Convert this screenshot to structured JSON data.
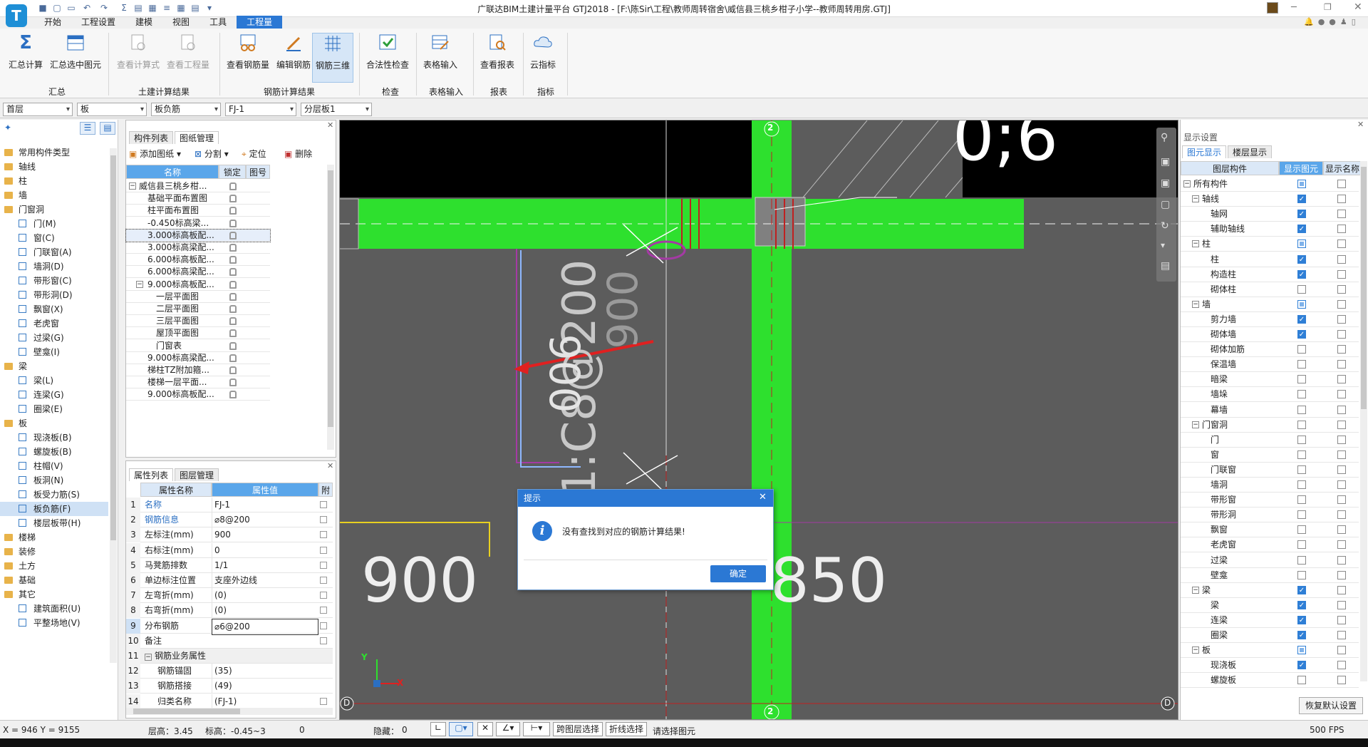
{
  "window": {
    "title": "广联达BIM土建计量平台 GTJ2018 - [F:\\陈Sir\\工程\\教师周转宿舍\\威信县三桃乡柑子小学--教师周转用房.GTJ]"
  },
  "menu": [
    "开始",
    "工程设置",
    "建模",
    "视图",
    "工具",
    "工程量"
  ],
  "ribbon": {
    "buttons": [
      "汇总计算",
      "汇总选中图元",
      "查看计算式",
      "查看工程量",
      "查看钢筋量",
      "编辑钢筋",
      "钢筋三维",
      "合法性检查",
      "表格输入",
      "查看报表",
      "云指标"
    ],
    "groups": [
      "汇总",
      "土建计算结果",
      "钢筋计算结果",
      "检查",
      "表格输入",
      "报表",
      "指标"
    ]
  },
  "combos": [
    "首层",
    "板",
    "板负筋",
    "FJ-1",
    "分层板1"
  ],
  "leftnav": {
    "items": [
      "常用构件类型",
      "轴线",
      "柱",
      "墙",
      "门窗洞",
      "门(M)",
      "窗(C)",
      "门联窗(A)",
      "墙洞(D)",
      "带形窗(C)",
      "带形洞(D)",
      "飘窗(X)",
      "老虎窗",
      "过梁(G)",
      "壁龛(I)",
      "梁",
      "梁(L)",
      "连梁(G)",
      "圈梁(E)",
      "板",
      "现浇板(B)",
      "螺旋板(B)",
      "柱帽(V)",
      "板洞(N)",
      "板受力筋(S)",
      "板负筋(F)",
      "楼层板带(H)",
      "楼梯",
      "装修",
      "土方",
      "基础",
      "其它",
      "建筑面积(U)",
      "平整场地(V)"
    ]
  },
  "drawings": {
    "tabs": [
      "构件列表",
      "图纸管理"
    ],
    "toolbar": [
      "添加图纸",
      "分割",
      "定位",
      "删除"
    ],
    "columns": [
      "名称",
      "锁定",
      "图号"
    ],
    "rows": [
      "威信县三桃乡柑...",
      "基础平面布置图",
      "柱平面布置图",
      "-0.450标高梁...",
      "3.000标高板配...",
      "3.000标高梁配...",
      "6.000标高板配...",
      "6.000标高梁配...",
      "9.000标高板配...",
      "一层平面图",
      "二层平面图",
      "三层平面图",
      "屋顶平面图",
      "门窗表",
      "9.000标高梁配...",
      "梯柱TZ附加箍...",
      "楼梯一层平面...",
      "9.000标高板配..."
    ]
  },
  "props": {
    "tabs": [
      "属性列表",
      "图层管理"
    ],
    "columns": [
      "属性名称",
      "属性值",
      "附"
    ],
    "rows": [
      {
        "n": "1",
        "name": "名称",
        "val": "FJ-1"
      },
      {
        "n": "2",
        "name": "钢筋信息",
        "val": "⌀8@200"
      },
      {
        "n": "3",
        "name": "左标注(mm)",
        "val": "900"
      },
      {
        "n": "4",
        "name": "右标注(mm)",
        "val": "0"
      },
      {
        "n": "5",
        "name": "马凳筋排数",
        "val": "1/1"
      },
      {
        "n": "6",
        "name": "单边标注位置",
        "val": "支座外边线"
      },
      {
        "n": "7",
        "name": "左弯折(mm)",
        "val": "(0)"
      },
      {
        "n": "8",
        "name": "右弯折(mm)",
        "val": "(0)"
      },
      {
        "n": "9",
        "name": "分布钢筋",
        "val": "⌀6@200"
      },
      {
        "n": "10",
        "name": "备注",
        "val": ""
      },
      {
        "n": "11",
        "name": "钢筋业务属性",
        "val": ""
      },
      {
        "n": "12",
        "name": "钢筋锚固",
        "val": "(35)"
      },
      {
        "n": "13",
        "name": "钢筋搭接",
        "val": "(49)"
      },
      {
        "n": "14",
        "name": "归类名称",
        "val": "(FJ-1)"
      }
    ]
  },
  "canvas": {
    "texts": {
      "beam_label": "FJ-1:C8@200",
      "dim_900_a": "900",
      "dim_900_b": "900",
      "dim_900_c": "900",
      "dim_850": "850",
      "big": "0;6",
      "axis_2": "2",
      "axis_d": "D",
      "x": "X",
      "y": "Y"
    }
  },
  "dialog": {
    "title": "提示",
    "message": "没有查找到对应的钢筋计算结果!",
    "ok": "确定"
  },
  "display": {
    "title": "显示设置",
    "tabs": [
      "图元显示",
      "楼层显示"
    ],
    "columns": [
      "图层构件",
      "显示图元",
      "显示名称"
    ],
    "rows": [
      {
        "name": "所有构件",
        "lvl": 0,
        "show": "part",
        "label": "off"
      },
      {
        "name": "轴线",
        "lvl": 1,
        "show": "on",
        "label": "off"
      },
      {
        "name": "轴网",
        "lvl": 2,
        "show": "on",
        "label": "off"
      },
      {
        "name": "辅助轴线",
        "lvl": 2,
        "show": "on",
        "label": "off"
      },
      {
        "name": "柱",
        "lvl": 1,
        "show": "part",
        "label": "off"
      },
      {
        "name": "柱",
        "lvl": 2,
        "show": "on",
        "label": "off"
      },
      {
        "name": "构造柱",
        "lvl": 2,
        "show": "on",
        "label": "off"
      },
      {
        "name": "砌体柱",
        "lvl": 2,
        "show": "off",
        "label": "off"
      },
      {
        "name": "墙",
        "lvl": 1,
        "show": "part",
        "label": "off"
      },
      {
        "name": "剪力墙",
        "lvl": 2,
        "show": "on",
        "label": "off"
      },
      {
        "name": "砌体墙",
        "lvl": 2,
        "show": "on",
        "label": "off"
      },
      {
        "name": "砌体加筋",
        "lvl": 2,
        "show": "off",
        "label": "off"
      },
      {
        "name": "保温墙",
        "lvl": 2,
        "show": "off",
        "label": "off"
      },
      {
        "name": "暗梁",
        "lvl": 2,
        "show": "off",
        "label": "off"
      },
      {
        "name": "墙垛",
        "lvl": 2,
        "show": "off",
        "label": "off"
      },
      {
        "name": "幕墙",
        "lvl": 2,
        "show": "off",
        "label": "off"
      },
      {
        "name": "门窗洞",
        "lvl": 1,
        "show": "off",
        "label": "off"
      },
      {
        "name": "门",
        "lvl": 2,
        "show": "off",
        "label": "off"
      },
      {
        "name": "窗",
        "lvl": 2,
        "show": "off",
        "label": "off"
      },
      {
        "name": "门联窗",
        "lvl": 2,
        "show": "off",
        "label": "off"
      },
      {
        "name": "墙洞",
        "lvl": 2,
        "show": "off",
        "label": "off"
      },
      {
        "name": "带形窗",
        "lvl": 2,
        "show": "off",
        "label": "off"
      },
      {
        "name": "带形洞",
        "lvl": 2,
        "show": "off",
        "label": "off"
      },
      {
        "name": "飘窗",
        "lvl": 2,
        "show": "off",
        "label": "off"
      },
      {
        "name": "老虎窗",
        "lvl": 2,
        "show": "off",
        "label": "off"
      },
      {
        "name": "过梁",
        "lvl": 2,
        "show": "off",
        "label": "off"
      },
      {
        "name": "壁龛",
        "lvl": 2,
        "show": "off",
        "label": "off"
      },
      {
        "name": "梁",
        "lvl": 1,
        "show": "on",
        "label": "off"
      },
      {
        "name": "梁",
        "lvl": 2,
        "show": "on",
        "label": "off"
      },
      {
        "name": "连梁",
        "lvl": 2,
        "show": "on",
        "label": "off"
      },
      {
        "name": "圈梁",
        "lvl": 2,
        "show": "on",
        "label": "off"
      },
      {
        "name": "板",
        "lvl": 1,
        "show": "part",
        "label": "off"
      },
      {
        "name": "现浇板",
        "lvl": 2,
        "show": "on",
        "label": "off"
      },
      {
        "name": "螺旋板",
        "lvl": 2,
        "show": "off",
        "label": "off"
      }
    ],
    "restore": "恢复默认设置"
  },
  "status": {
    "coords": "X = 946 Y = 9155",
    "floor_height": "层高：3.45",
    "elevation": "标高：-0.45~3",
    "zero": "0",
    "hidden": "隐藏：",
    "hidden_val": "0",
    "cross_layer": "跨图层选择",
    "polyline": "折线选择",
    "prompt": "请选择图元",
    "fps": "500 FPS"
  }
}
